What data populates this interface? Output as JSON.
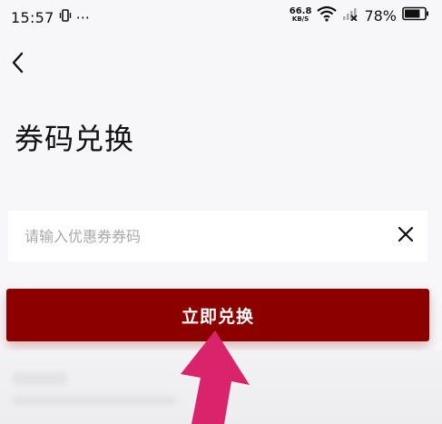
{
  "status_bar": {
    "time": "15:57",
    "dots": "···",
    "net_speed_value": "66.8",
    "net_speed_unit": "KB/S",
    "battery": "78%",
    "battery_level": 0.78
  },
  "page": {
    "title": "券码兑换"
  },
  "coupon": {
    "placeholder": "请输入优惠券券码",
    "value": ""
  },
  "actions": {
    "redeem_label": "立即兑换"
  },
  "colors": {
    "accent": "#8c0000",
    "pointer": "#d9246c"
  },
  "icons": [
    "back-icon",
    "clear-icon",
    "vibrate-icon",
    "wifi-icon",
    "signal-icon",
    "battery-icon"
  ]
}
